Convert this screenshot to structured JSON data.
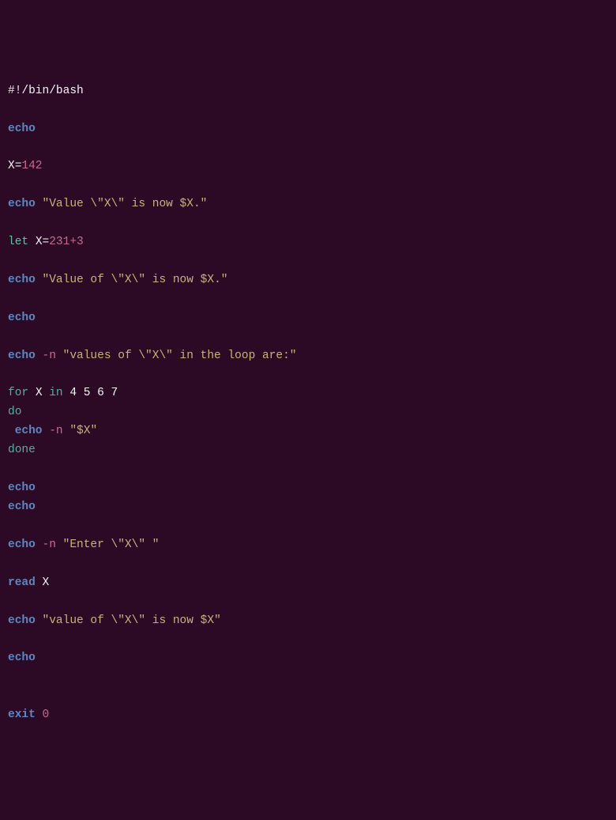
{
  "code": {
    "shebang_hash": "#!",
    "shebang_path": "/bin/bash",
    "echo": "echo",
    "let": "let",
    "for": "for",
    "in": "in",
    "do": "do",
    "done": "done",
    "read": "read",
    "exit": "exit",
    "var_X": "X",
    "assign_op": "=",
    "val_142": "142",
    "val_231_3": "231+3",
    "flag_n": "-n",
    "space": " ",
    "num_0": "0",
    "num_4": "4",
    "num_5": "5",
    "num_6": "6",
    "num_7": "7",
    "str1_open": "\"Value \\\"X\\\" is now ",
    "str1_var": "$X",
    "str1_close": ".\"",
    "str2_open": "\"Value of \\\"X\\\" is now ",
    "str2_var": "$X",
    "str2_close": ".\"",
    "str3_full": "\"values of \\\"X\\\" in the loop are:\"",
    "str4_open": "\"",
    "str4_var": "$X",
    "str4_close": "\"",
    "str5_full": "\"Enter \\\"X\\\" \"",
    "str6_open": "\"value of \\\"X\\\" is now ",
    "str6_var": "$X",
    "str6_close": "\""
  }
}
